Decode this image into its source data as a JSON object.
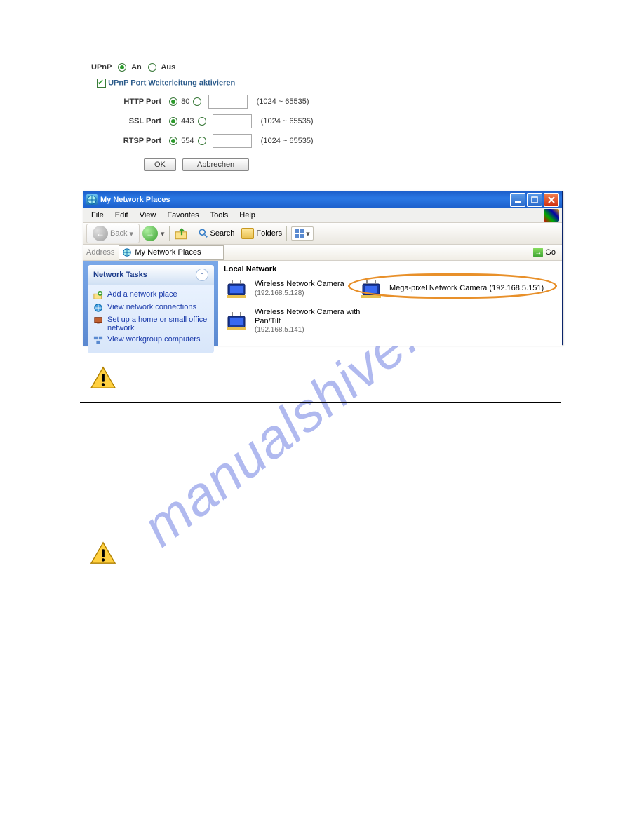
{
  "upnp": {
    "label": "UPnP",
    "on_label": "An",
    "off_label": "Aus",
    "checkbox_label": "UPnP Port Weiterleitung aktivieren",
    "ports": [
      {
        "label": "HTTP Port",
        "default_value": "80",
        "range": "(1024 ~ 65535)"
      },
      {
        "label": "SSL Port",
        "default_value": "443",
        "range": "(1024 ~ 65535)"
      },
      {
        "label": "RTSP Port",
        "default_value": "554",
        "range": "(1024 ~ 65535)"
      }
    ],
    "buttons": {
      "ok": "OK",
      "cancel": "Abbrechen"
    }
  },
  "xp": {
    "title": "My Network Places",
    "menu": [
      "File",
      "Edit",
      "View",
      "Favorites",
      "Tools",
      "Help"
    ],
    "toolbar": {
      "back": "Back",
      "search": "Search",
      "folders": "Folders"
    },
    "addressbar": {
      "label": "Address",
      "value": "My Network Places",
      "go": "Go"
    },
    "sidebar": {
      "heading": "Network Tasks",
      "items": [
        "Add a network place",
        "View network connections",
        "Set up a home or small office network",
        "View workgroup computers"
      ]
    },
    "main": {
      "heading": "Local Network",
      "devices": [
        {
          "name": "Wireless Network Camera",
          "ip": "(192.168.5.128)"
        },
        {
          "name": "Mega-pixel Network Camera (192.168.5.151)",
          "ip": ""
        },
        {
          "name": "Wireless Network Camera with Pan/Tilt",
          "ip": "(192.168.5.141)"
        }
      ]
    }
  },
  "watermark": "manualshive.com"
}
